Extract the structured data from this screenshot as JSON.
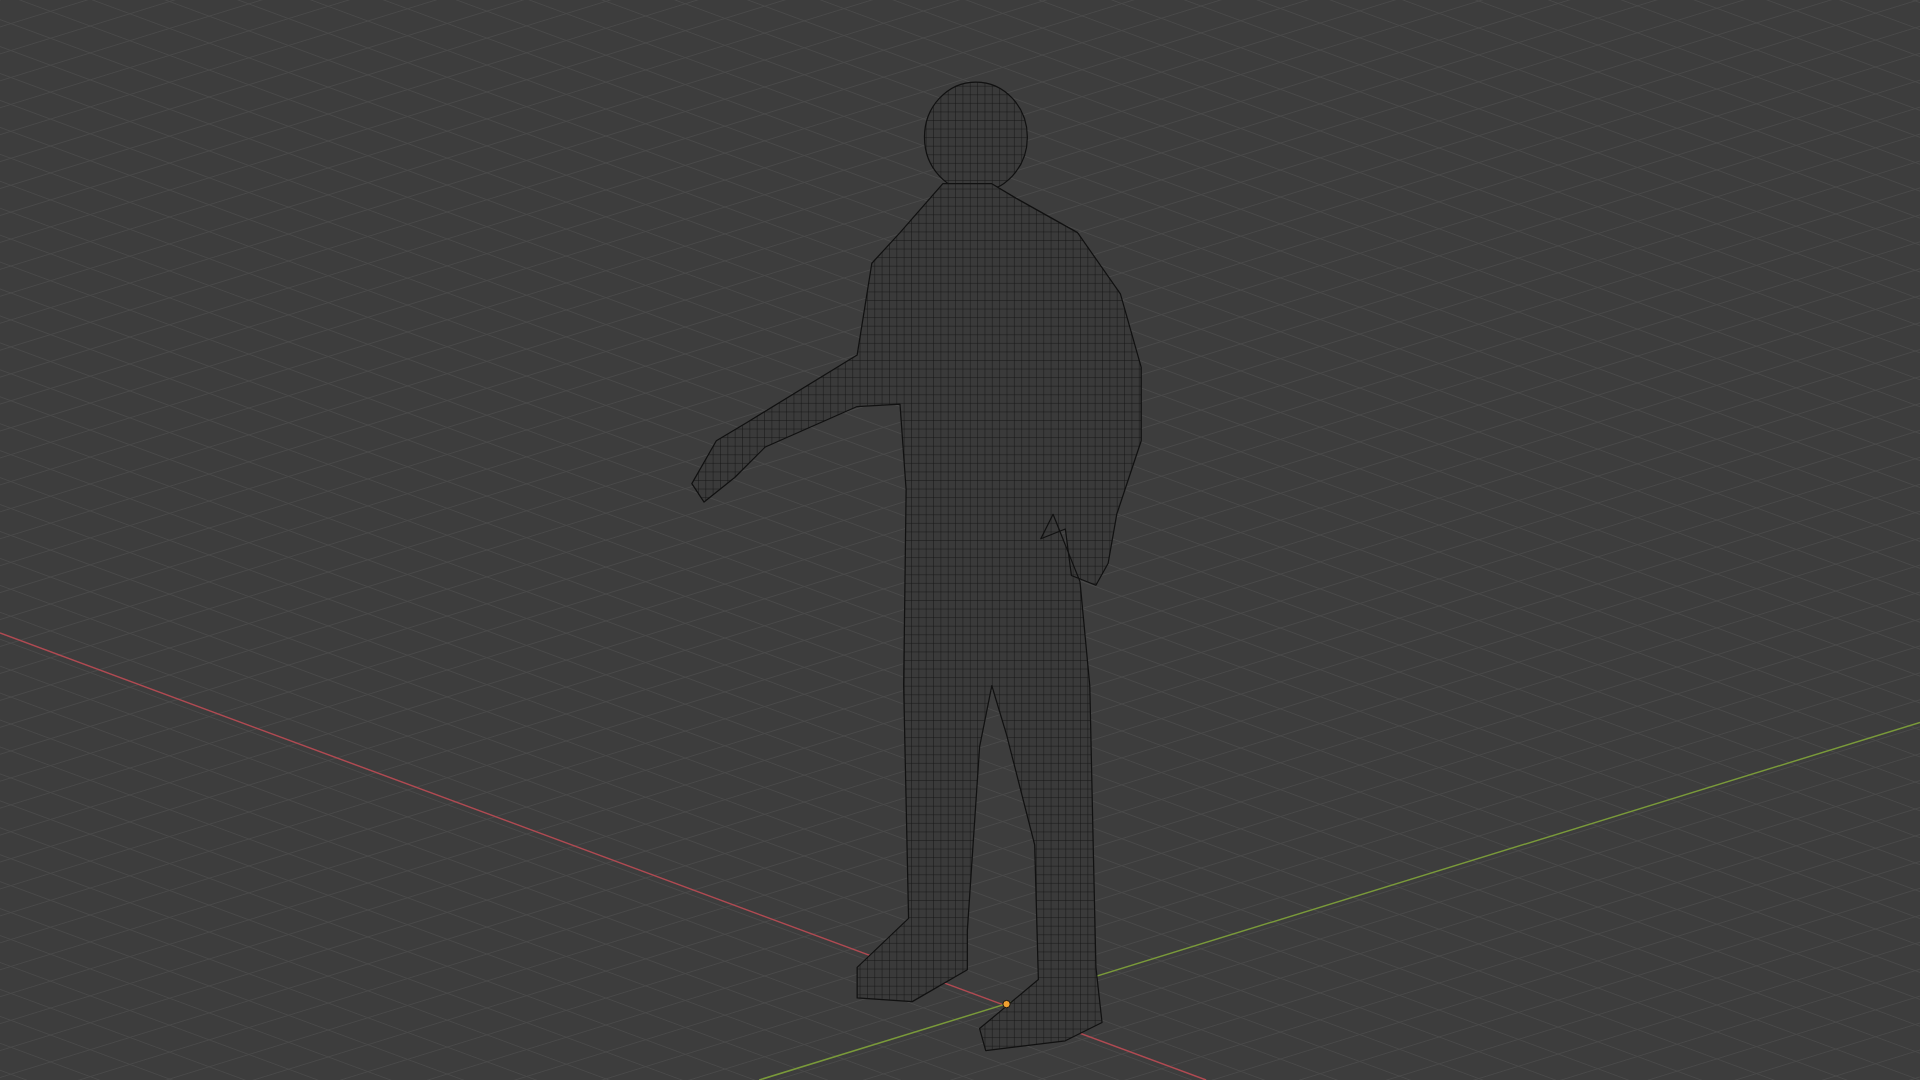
{
  "viewport": {
    "wireframe": true,
    "object": {
      "selected": true
    }
  }
}
